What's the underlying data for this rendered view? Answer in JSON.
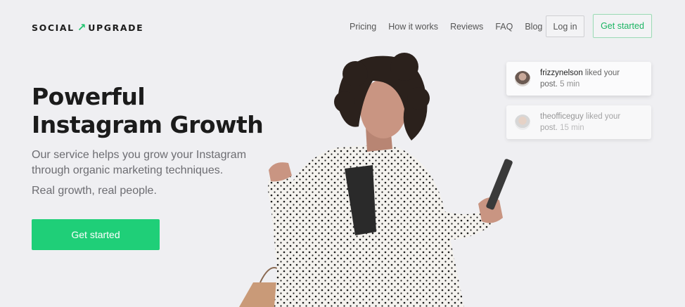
{
  "header": {
    "logo_left": "SOCIAL",
    "logo_arrow": "↗",
    "logo_right": "UPGRADE",
    "nav": [
      "Pricing",
      "How it works",
      "Reviews",
      "FAQ",
      "Blog"
    ],
    "login_label": "Log in",
    "cta_label": "Get started"
  },
  "hero": {
    "title_line1": "Powerful",
    "title_line2": "Instagram Growth",
    "description": "Our service helps you grow your Instagram through organic marketing techniques.",
    "tagline": "Real growth, real people.",
    "cta_label": "Get started"
  },
  "notifications": [
    {
      "user": "frizzynelson",
      "action": " liked your post.",
      "time": " 5 min"
    },
    {
      "user": "theofficeguy",
      "action": " liked your post.",
      "time": " 15 min"
    }
  ],
  "colors": {
    "accent": "#1fcf78",
    "background": "#efeff2"
  }
}
